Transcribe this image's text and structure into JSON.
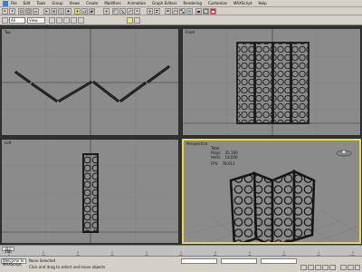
{
  "menu": {
    "items": [
      "File",
      "Edit",
      "Tools",
      "Group",
      "Views",
      "Create",
      "Modifiers",
      "Animation",
      "Graph Editors",
      "Rendering",
      "Customize",
      "MAXScript",
      "Help"
    ]
  },
  "toolbar": {
    "selection_set": "All",
    "view_combo": "View"
  },
  "viewports": {
    "top": {
      "label": "Top"
    },
    "front": {
      "label": "Front"
    },
    "left": {
      "label": "Left"
    },
    "perspective": {
      "label": "Perspective",
      "stats": {
        "title": "Total",
        "polys_label": "Polys:",
        "polys_value": "35,160",
        "verts_label": "Verts:",
        "verts_value": "18,000",
        "fps_label": "FPS:",
        "fps_value": "78.013"
      }
    }
  },
  "timeline": {
    "frame_counter": "0 / 100",
    "ticks": [
      "0",
      "10",
      "20",
      "30",
      "40",
      "50",
      "60",
      "70",
      "80",
      "90",
      "100"
    ]
  },
  "status": {
    "selection_info": "None Selected",
    "prompt": "Click and drag to select and move objects",
    "prompt_secondary": "Welcome to MAXScript."
  },
  "colors": {
    "viewport_bg": "#8b8b8b",
    "active_border": "#e8d84a",
    "model": "#1a1a1a"
  }
}
